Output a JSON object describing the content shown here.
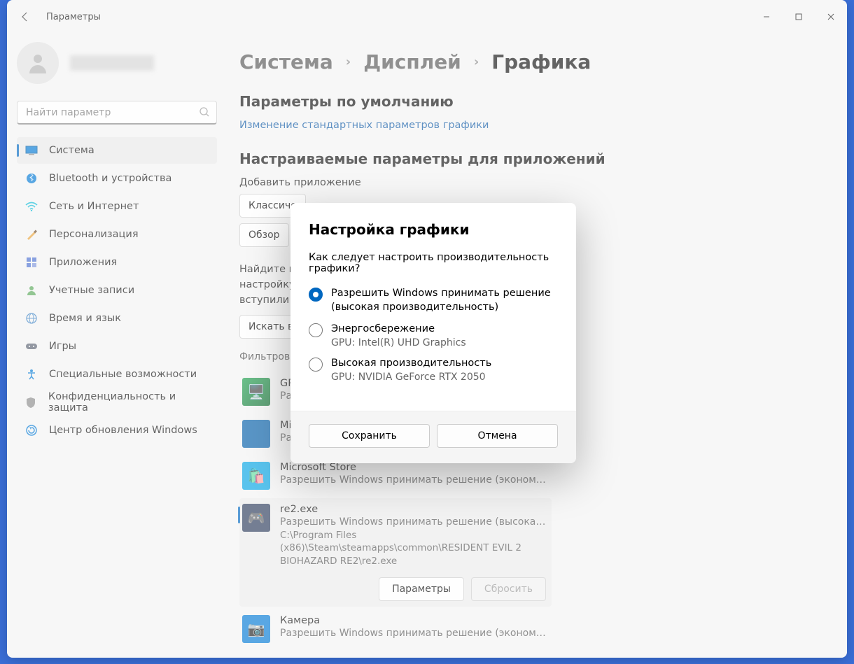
{
  "window": {
    "title": "Параметры"
  },
  "search": {
    "placeholder": "Найти параметр"
  },
  "nav": {
    "items": [
      {
        "label": "Система"
      },
      {
        "label": "Bluetooth и устройства"
      },
      {
        "label": "Сеть и Интернет"
      },
      {
        "label": "Персонализация"
      },
      {
        "label": "Приложения"
      },
      {
        "label": "Учетные записи"
      },
      {
        "label": "Время и язык"
      },
      {
        "label": "Игры"
      },
      {
        "label": "Специальные возможности"
      },
      {
        "label": "Конфиденциальность и защита"
      },
      {
        "label": "Центр обновления Windows"
      }
    ]
  },
  "breadcrumb": {
    "a": "Система",
    "b": "Дисплей",
    "c": "Графика"
  },
  "main": {
    "defaults_title": "Параметры по умолчанию",
    "defaults_link": "Изменение стандартных параметров графики",
    "custom_title": "Настраиваемые параметры для приложений",
    "add_label": "Добавить приложение",
    "combo1": "Классиче",
    "combo2": "Обзор",
    "hint": "Найдите приложение в списке и выберите для него настройку, затем перезапустите его, чтобы изменения вступили в",
    "search_in": "Искать в",
    "filter": "Фильтрова"
  },
  "apps": [
    {
      "name": "GPU",
      "sub": "Раз"
    },
    {
      "name": "Mic",
      "sub": "Раз"
    },
    {
      "name": "Microsoft Store",
      "sub": "Разрешить Windows принимать решение (экономия эне..."
    },
    {
      "name": "re2.exe",
      "sub": "Разрешить Windows принимать решение (высокая прои...",
      "path": "C:\\Program Files (x86)\\Steam\\steamapps\\common\\RESIDENT EVIL 2  BIOHAZARD RE2\\re2.exe",
      "btn_params": "Параметры",
      "btn_reset": "Сбросить"
    },
    {
      "name": "Камера",
      "sub": "Разрешить Windows принимать решение (экономия эне..."
    }
  ],
  "dialog": {
    "title": "Настройка графики",
    "question": "Как следует настроить производительность графики?",
    "opt1": "Разрешить Windows принимать решение (высокая производительность)",
    "opt2": "Энергосбережение",
    "opt2_sub": "GPU: Intel(R) UHD Graphics",
    "opt3": "Высокая производительность",
    "opt3_sub": "GPU: NVIDIA GeForce RTX 2050",
    "save": "Сохранить",
    "cancel": "Отмена"
  }
}
